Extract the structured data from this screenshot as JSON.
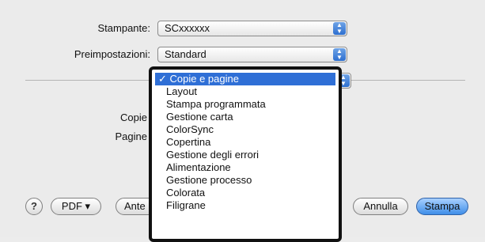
{
  "form": {
    "printer_label": "Stampante:",
    "printer_value": "SCxxxxxx",
    "presets_label": "Preimpostazioni:",
    "presets_value": "Standard",
    "copies_label": "Copie",
    "pages_label": "Pagine"
  },
  "menu": {
    "items": [
      "✓ Copie e pagine",
      "Layout",
      "Stampa programmata",
      "Gestione carta",
      "ColorSync",
      "Copertina",
      "Gestione degli errori",
      "Alimentazione",
      "Gestione processo",
      "Colorata",
      "Filigrane"
    ]
  },
  "buttons": {
    "help": "?",
    "pdf": "PDF ▾",
    "preview": "Ante",
    "cancel": "Annulla",
    "print": "Stampa"
  },
  "colors": {
    "selection": "#2f6fd6",
    "default_button": "#3f8ee8",
    "highlight_frame": "#111111"
  }
}
